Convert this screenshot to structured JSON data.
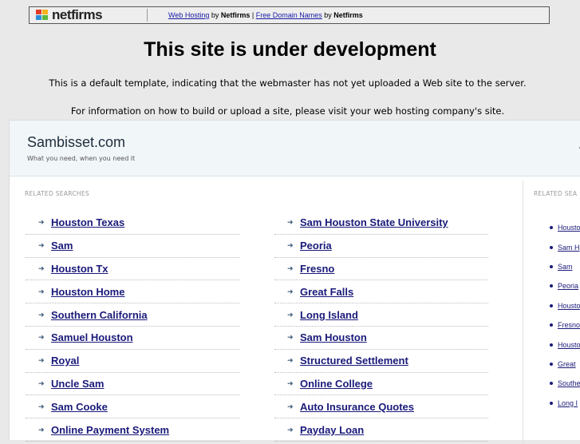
{
  "netfirms_bar": {
    "logo_text": "netfirms",
    "link1": "Web Hosting",
    "by1": " by ",
    "brand1": "Netfirms",
    "sep": " | ",
    "link2": "Free Domain Names",
    "by2": " by ",
    "brand2": "Netfirms"
  },
  "headline": "This site is under development",
  "intro_line1": "This is a default template, indicating that the webmaster has not yet uploaded a Web site to the server.",
  "intro_line2": "For information on how to build or upload a site, please visit your web hosting company's site.",
  "site": {
    "name": "Sambisset.com",
    "tagline": "What you need, when you need it",
    "head_mark": "A"
  },
  "related_label": "RELATED SEARCHES",
  "related_label_right": "RELATED SEA",
  "left_links": [
    "Houston Texas",
    "Sam",
    "Houston Tx",
    "Houston Home",
    "Southern California",
    "Samuel Houston",
    "Royal",
    "Uncle Sam",
    "Sam Cooke",
    "Online Payment System"
  ],
  "right_links": [
    "Sam Houston State University",
    "Peoria",
    "Fresno",
    "Great Falls",
    "Long Island",
    "Sam Houston",
    "Structured Settlement",
    "Online College",
    "Auto Insurance Quotes",
    "Payday Loan"
  ],
  "side_links": [
    "Housto",
    "Sam H",
    "Sam",
    "Peoria",
    "Housto",
    "Fresno",
    "Housto",
    "Great",
    "Southe",
    "Long I"
  ],
  "colors": {
    "link": "#1a1a7a",
    "header_bg": "#f1f6f8",
    "page_bg": "#e9e9e9"
  }
}
